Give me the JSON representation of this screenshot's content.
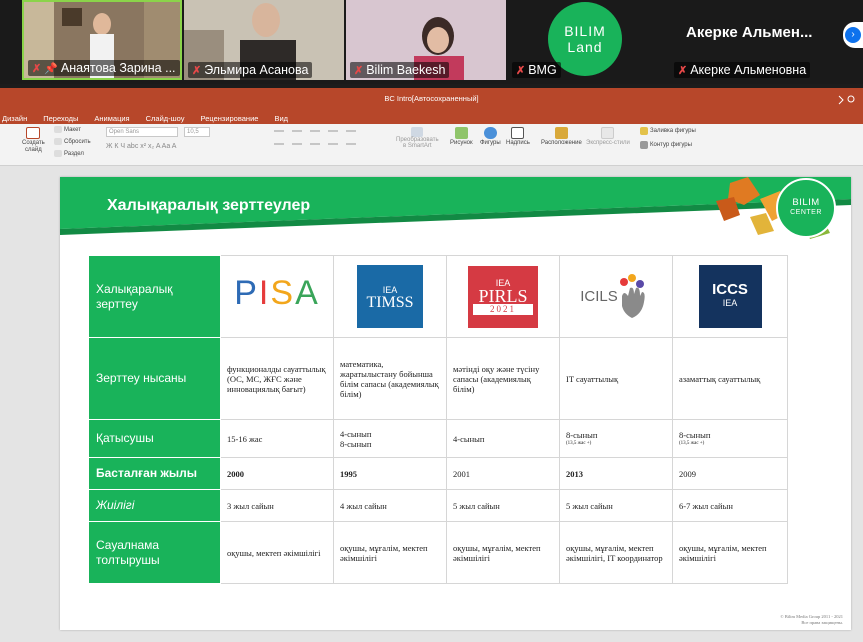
{
  "participants": [
    {
      "name": "Анаятова Зарина ...",
      "muted": true,
      "pinned": true
    },
    {
      "name": "Эльмира Асанова",
      "muted": true
    },
    {
      "name": "Bilim Baekesh",
      "muted": true
    },
    {
      "name": "BMG",
      "muted": true,
      "logo_line1": "BILIM",
      "logo_line2": "Land"
    },
    {
      "name": "Акерке Альменовна",
      "muted": true,
      "display_name": "Акерке  Альмен..."
    }
  ],
  "window": {
    "title": "BC Intro[Автосохраненный]"
  },
  "ribbon": {
    "tabs": [
      "Дизайн",
      "Переходы",
      "Анимация",
      "Слайд-шоу",
      "Рецензирование",
      "Вид"
    ],
    "new_slide": [
      "Создать",
      "слайд"
    ],
    "layout": "Макет",
    "reset": "Сбросить",
    "section": "Раздел",
    "font": "Open Sans",
    "font_size": "10,5",
    "smartart": [
      "Преобразовать",
      "в SmartArt"
    ],
    "picture": "Рисунок",
    "shapes": "Фигуры",
    "textbox": "Надпись",
    "arrange": "Расположение",
    "quick_styles": "Экспресс-стили",
    "shape_fill": "Заливка фигуры",
    "shape_outline": "Контур фигуры"
  },
  "slide": {
    "title": "Халықаралық зерттеулер",
    "brand_line1": "BILIM",
    "brand_line2": "CENTER",
    "copyright_1": "© Bilim Media Group 2011 - 2021",
    "copyright_2": "Все права защищены.",
    "table": {
      "header_label": "Халықаралық зерттеу",
      "logos": {
        "pisa": "PISA",
        "timss": {
          "org": "IEA",
          "name": "TIMSS"
        },
        "pirls": {
          "org": "IEA",
          "name": "PIRLS",
          "year": "2021"
        },
        "icils": "ICILS",
        "iccs": {
          "name": "ICCS",
          "org": "IEA"
        }
      },
      "rows": [
        {
          "label": "Зерттеу нысаны",
          "cells": [
            "функционалды сауаттылық (ОС, МС, ЖҒС және инновациялық бағыт)",
            "математика, жаратылыстану бойынша білім сапасы (академиялық білім)",
            "мәтінді оқу және түсіну сапасы (академиялық білім)",
            "IT сауаттылық",
            "азаматтық сауаттылық"
          ]
        },
        {
          "label": "Қатысушы",
          "cells": [
            "15-16 жас",
            "4-сынып",
            "4-сынып",
            "8-сынып",
            "8-сынып"
          ],
          "extra": [
            "",
            "8-сынып",
            "",
            "(13,5 жас +)",
            "(13,5 жас +)"
          ]
        },
        {
          "label": "Басталған жылы",
          "cells": [
            "2000",
            "1995",
            "2001",
            "2013",
            "2009"
          ]
        },
        {
          "label": "Жиілігі",
          "cells": [
            "3 жыл сайын",
            "4 жыл сайын",
            "5 жыл сайын",
            "5 жыл сайын",
            "6-7 жыл сайын"
          ]
        },
        {
          "label": "Сауалнама толтырушы",
          "cells": [
            "оқушы, мектеп әкімшілігі",
            "оқушы, мұғалім, мектеп әкімшілігі",
            "оқушы, мұғалім, мектеп әкімшілігі",
            "оқушы, мұғалім, мектеп әкімшілігі, IT координатор",
            "оқушы, мұғалім, мектеп әкімшілігі"
          ]
        }
      ]
    }
  }
}
